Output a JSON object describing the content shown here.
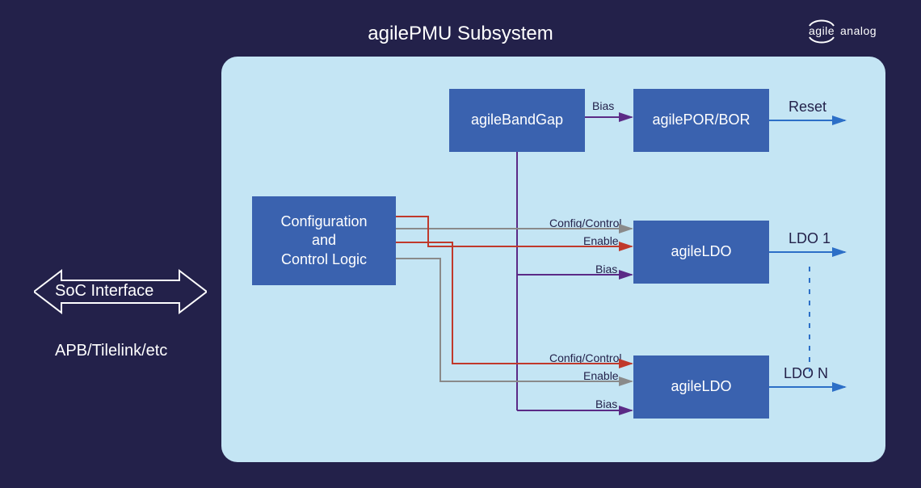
{
  "title": "agilePMU Subsystem",
  "logo": {
    "brand1": "agile",
    "brand2": "analog"
  },
  "blocks": {
    "config": "Configuration\nand\nControl Logic",
    "bandgap": "agileBandGap",
    "porbor": "agilePOR/BOR",
    "ldo1": "agileLDO",
    "ldoN": "agileLDO"
  },
  "soc": {
    "interface": "SoC Interface",
    "bus": "APB/Tilelink/etc"
  },
  "edges": {
    "bias_top": "Bias",
    "config_control_1": "Config/Control",
    "enable_1": "Enable",
    "bias_1": "Bias",
    "config_control_2": "Config/Control",
    "enable_2": "Enable",
    "bias_2": "Bias"
  },
  "outputs": {
    "reset": "Reset",
    "ldo1": "LDO 1",
    "ldoN": "LDO N"
  },
  "colors": {
    "gray": "#8a8a8a",
    "red": "#c0392b",
    "purple": "#5b2a86",
    "blue": "#2c6fc7"
  }
}
